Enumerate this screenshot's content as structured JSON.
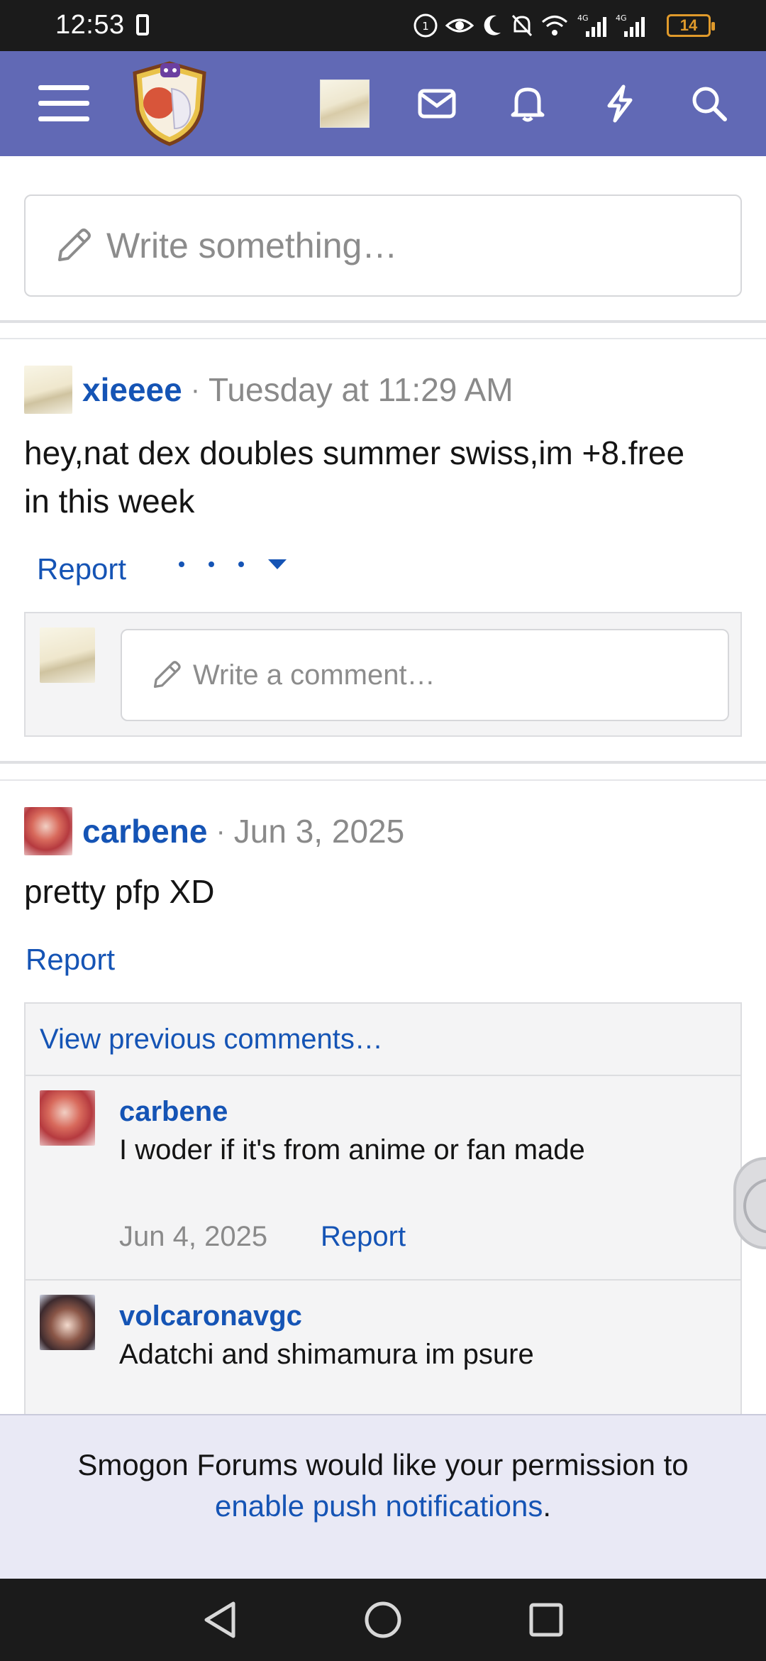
{
  "status": {
    "time": "12:53",
    "network1": "4G",
    "network2": "4G",
    "battery": "14"
  },
  "header": {
    "icons": [
      "menu-icon",
      "site-logo",
      "user-avatar",
      "mail-icon",
      "bell-icon",
      "bolt-icon",
      "search-icon"
    ]
  },
  "composer": {
    "placeholder": "Write something…"
  },
  "posts": [
    {
      "author": "xieeee",
      "date": "Tuesday at 11:29 AM",
      "body_line1": "hey,nat dex doubles summer swiss,im +8.free",
      "body_line2": "in this week",
      "report": "Report",
      "comment_placeholder": "Write a comment…"
    },
    {
      "author": "carbene",
      "date": "Jun 3, 2025",
      "body": "pretty pfp XD",
      "report": "Report",
      "view_previous": "View previous comments…",
      "comments": [
        {
          "author": "carbene",
          "text": "I woder if it's from anime or fan made",
          "date": "Jun 4, 2025",
          "report": "Report"
        },
        {
          "author": "volcaronavgc",
          "text": "Adatchi and shimamura im psure"
        }
      ]
    }
  ],
  "push": {
    "line1": "Smogon Forums would like your permission to",
    "link": "enable push notifications",
    "suffix": "."
  },
  "colors": {
    "header": "#6169b5",
    "link": "#1554b5",
    "muted": "#8a8a8a"
  }
}
